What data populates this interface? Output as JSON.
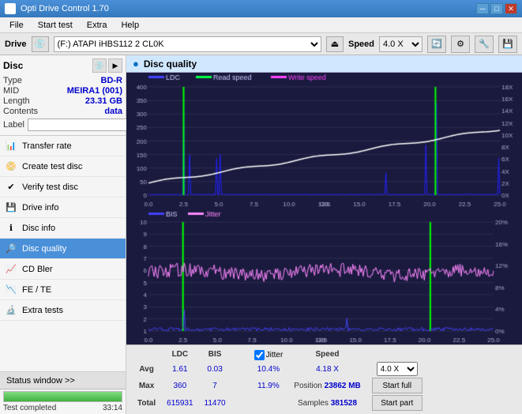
{
  "titlebar": {
    "title": "Opti Drive Control 1.70",
    "controls": [
      "minimize",
      "maximize",
      "close"
    ]
  },
  "menubar": {
    "items": [
      "File",
      "Start test",
      "Extra",
      "Help"
    ]
  },
  "drivebar": {
    "drive_label": "Drive",
    "drive_value": "(F:)  ATAPI iHBS112  2 CL0K",
    "speed_label": "Speed",
    "speed_value": "4.0 X"
  },
  "disc": {
    "title": "Disc",
    "type_label": "Type",
    "type_value": "BD-R",
    "mid_label": "MID",
    "mid_value": "MEIRA1 (001)",
    "length_label": "Length",
    "length_value": "23.31 GB",
    "contents_label": "Contents",
    "contents_value": "data",
    "label_label": "Label",
    "label_value": ""
  },
  "nav": {
    "items": [
      {
        "id": "transfer-rate",
        "label": "Transfer rate",
        "active": false
      },
      {
        "id": "create-test-disc",
        "label": "Create test disc",
        "active": false
      },
      {
        "id": "verify-test-disc",
        "label": "Verify test disc",
        "active": false
      },
      {
        "id": "drive-info",
        "label": "Drive info",
        "active": false
      },
      {
        "id": "disc-info",
        "label": "Disc info",
        "active": false
      },
      {
        "id": "disc-quality",
        "label": "Disc quality",
        "active": true
      },
      {
        "id": "cd-bler",
        "label": "CD Bler",
        "active": false
      },
      {
        "id": "fe-te",
        "label": "FE / TE",
        "active": false
      },
      {
        "id": "extra-tests",
        "label": "Extra tests",
        "active": false
      }
    ]
  },
  "status": {
    "btn_label": "Status window >>",
    "progress": 100,
    "status_text": "Test completed",
    "time": "33:14"
  },
  "chart": {
    "title": "Disc quality",
    "legend": [
      {
        "label": "LDC",
        "color": "#0000ff"
      },
      {
        "label": "Read speed",
        "color": "#00ff00"
      },
      {
        "label": "Write speed",
        "color": "#ff00ff"
      }
    ],
    "legend2": [
      {
        "label": "BIS",
        "color": "#0000ff"
      },
      {
        "label": "Jitter",
        "color": "#ff66ff"
      }
    ]
  },
  "stats": {
    "columns": [
      "",
      "LDC",
      "BIS",
      "",
      "Jitter",
      "Speed",
      ""
    ],
    "avg_label": "Avg",
    "avg_ldc": "1.61",
    "avg_bis": "0.03",
    "avg_jitter": "10.4%",
    "avg_speed": "4.18 X",
    "speed_select": "4.0 X",
    "max_label": "Max",
    "max_ldc": "360",
    "max_bis": "7",
    "max_jitter": "11.9%",
    "position_label": "Position",
    "position_value": "23862 MB",
    "total_label": "Total",
    "total_ldc": "615931",
    "total_bis": "11470",
    "samples_label": "Samples",
    "samples_value": "381528",
    "start_full_label": "Start full",
    "start_part_label": "Start part"
  }
}
